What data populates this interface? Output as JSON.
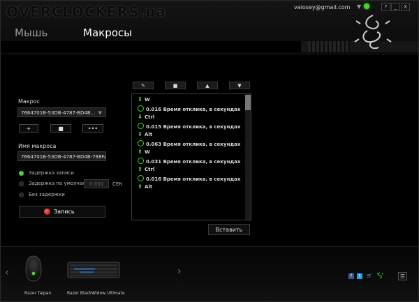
{
  "app": {
    "brand": "OVERCLOCKERS.ua",
    "email": "vaiosey@gmail.com",
    "window_controls": [
      "?",
      "_",
      "X"
    ]
  },
  "tabs": [
    {
      "label": "Мышь"
    },
    {
      "label": "Макросы"
    }
  ],
  "left": {
    "macro_label": "Макрос",
    "macro_select": "7664701B-53DB-4787-BD4B...",
    "buttons": [
      "+",
      "■",
      "•••"
    ],
    "name_label": "Имя макроса",
    "name_value": "7664701B-53DB-4787-BD4B-788FA",
    "options": [
      {
        "label": "Задержка записи",
        "selected": true
      },
      {
        "label": "Задержка по умолчанию",
        "selected": false
      },
      {
        "label": "Без задержки",
        "selected": false
      }
    ],
    "default_delay": "0.050",
    "delay_unit": "СЕК",
    "record_label": "Запись"
  },
  "toolbar": [
    "✎",
    "■",
    "▲",
    "▼"
  ],
  "events": [
    {
      "type": "down",
      "text": "W"
    },
    {
      "type": "delay",
      "text": "0.016 Время отклика, в секундах"
    },
    {
      "type": "down",
      "text": "Ctrl"
    },
    {
      "type": "delay",
      "text": "0.015 Время отклика, в секундах"
    },
    {
      "type": "down",
      "text": "Alt"
    },
    {
      "type": "delay",
      "text": "0.063 Время отклика, в секундах"
    },
    {
      "type": "up",
      "text": "W"
    },
    {
      "type": "delay",
      "text": "0.031 Время отклика, в секундах"
    },
    {
      "type": "up",
      "text": "Ctrl"
    },
    {
      "type": "delay",
      "text": "0.016 Время отклика, в секундах"
    },
    {
      "type": "up",
      "text": "Alt"
    }
  ],
  "insert_label": "Вставить",
  "devices": [
    {
      "label": "Razer Taipan"
    },
    {
      "label": "Razer BlackWidow Ultimate"
    }
  ],
  "colors": {
    "accent": "#44d62c",
    "record": "#e00000"
  }
}
